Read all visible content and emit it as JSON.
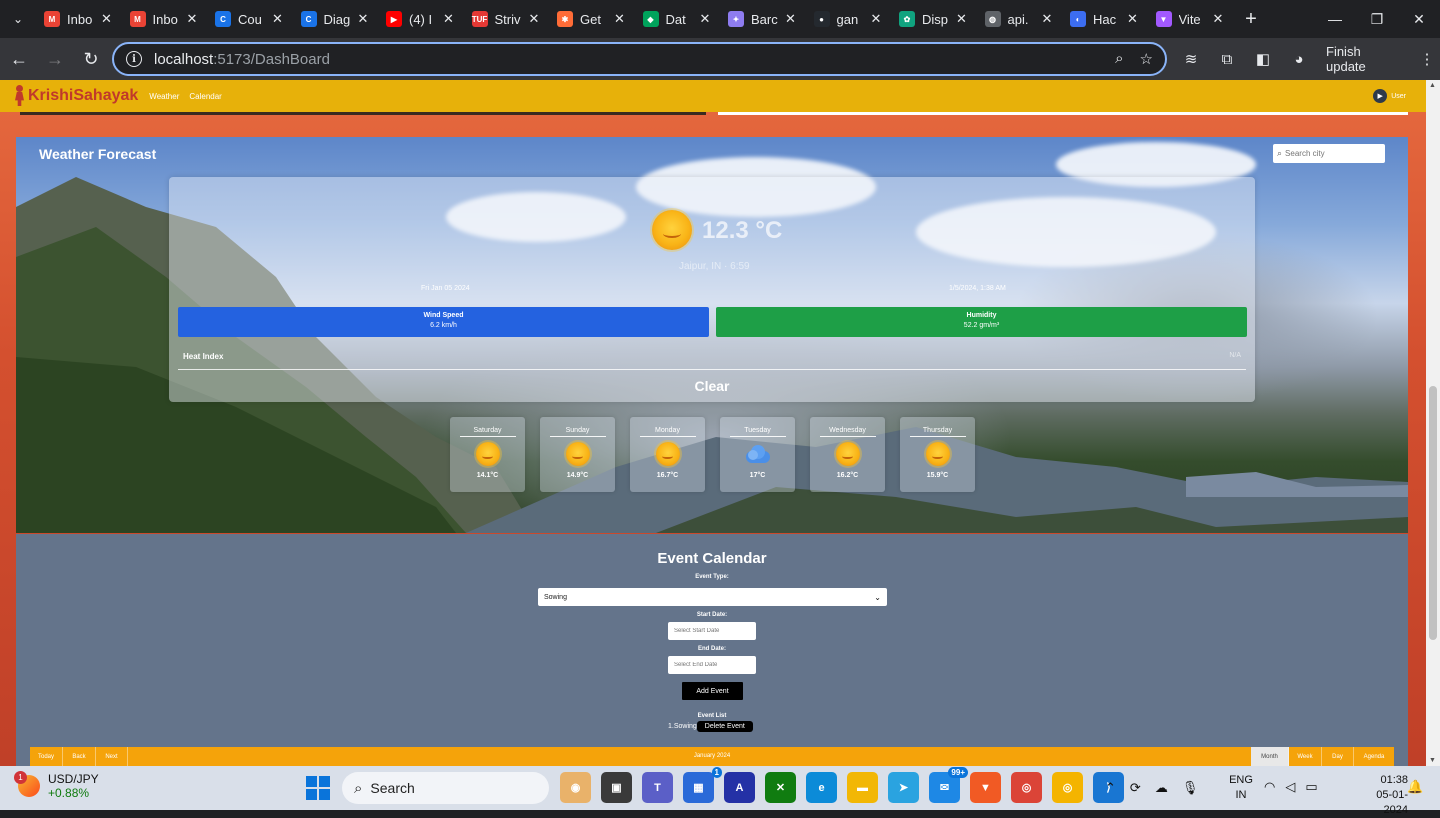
{
  "browser": {
    "tabs": [
      {
        "label": "Inbo",
        "icon": "gmail-icon",
        "color": "#ea4335",
        "glyph": "M"
      },
      {
        "label": "Inbo",
        "icon": "gmail-icon",
        "color": "#ea4335",
        "glyph": "M"
      },
      {
        "label": "Cou",
        "icon": "coursera-icon",
        "color": "#1a73e8",
        "glyph": "C"
      },
      {
        "label": "Diag",
        "icon": "coursera-icon",
        "color": "#1a73e8",
        "glyph": "C"
      },
      {
        "label": "(4) I",
        "icon": "youtube-icon",
        "color": "#ff0000",
        "glyph": "▶"
      },
      {
        "label": "Striv",
        "icon": "tuf-icon",
        "color": "#e53935",
        "glyph": "TUF"
      },
      {
        "label": "Get",
        "icon": "postman-icon",
        "color": "#ff6c37",
        "glyph": "✱"
      },
      {
        "label": "Dat",
        "icon": "mongodb-icon",
        "color": "#00a35c",
        "glyph": "◆"
      },
      {
        "label": "Barc",
        "icon": "bard-icon",
        "color": "#8e7cf0",
        "glyph": "✦"
      },
      {
        "label": "gan",
        "icon": "github-icon",
        "color": "#24292f",
        "glyph": "●"
      },
      {
        "label": "Disp",
        "icon": "chatgpt-icon",
        "color": "#10a37f",
        "glyph": "✿"
      },
      {
        "label": "api.",
        "icon": "globe-icon",
        "color": "#5f6368",
        "glyph": "◍"
      },
      {
        "label": "Hac",
        "icon": "hackathon-icon",
        "color": "#3c6df0",
        "glyph": "◐"
      },
      {
        "label": "Vite",
        "icon": "vite-icon",
        "color": "#a259ff",
        "glyph": "▼"
      }
    ],
    "url_host": "localhost",
    "url_path": ":5173/DashBoard",
    "finish_update": "Finish update"
  },
  "app": {
    "brand": "KrishiSahayak",
    "nav": [
      "Weather",
      "Calendar"
    ],
    "user": "User"
  },
  "weather": {
    "title": "Weather Forecast",
    "search_placeholder": "Search city",
    "current": {
      "temp": "12.3 °C",
      "location": "Jaipur, IN · 6:59",
      "date": "Fri Jan 05 2024",
      "time": "1/5/2024, 1:38 AM",
      "wind_label": "Wind Speed",
      "wind_value": "6.2 km/h",
      "humidity_label": "Humidity",
      "humidity_value": "52.2 gm/m³",
      "heat_label": "Heat Index",
      "heat_value": "N/A",
      "condition": "Clear"
    },
    "forecast": [
      {
        "day": "Saturday",
        "temp": "14.1°C",
        "icon": "sun-icon"
      },
      {
        "day": "Sunday",
        "temp": "14.9°C",
        "icon": "sun-icon"
      },
      {
        "day": "Monday",
        "temp": "16.7°C",
        "icon": "sun-icon"
      },
      {
        "day": "Tuesday",
        "temp": "17°C",
        "icon": "cloud-icon"
      },
      {
        "day": "Wednesday",
        "temp": "16.2°C",
        "icon": "sun-icon"
      },
      {
        "day": "Thursday",
        "temp": "15.9°C",
        "icon": "sun-icon"
      }
    ]
  },
  "calendar": {
    "title": "Event Calendar",
    "event_type_label": "Event Type:",
    "event_type_value": "Sowing",
    "start_label": "Start Date:",
    "start_placeholder": "Select Start Date",
    "end_label": "End Date:",
    "end_placeholder": "Select End Date",
    "add_button": "Add Event",
    "list_label": "Event List",
    "events": [
      {
        "name": "1.Sowing",
        "delete": "Delete Event"
      }
    ],
    "toolbar": {
      "today": "Today",
      "back": "Back",
      "next": "Next",
      "month_label": "January 2024",
      "views": [
        "Month",
        "Week",
        "Day",
        "Agenda"
      ],
      "active_view": "Month"
    }
  },
  "taskbar": {
    "ticker_name": "USD/JPY",
    "ticker_change": "+0.88%",
    "ticker_badge": "1",
    "search": "Search",
    "mail_badge": "99+",
    "store_badge": "1",
    "lang_top": "ENG",
    "lang_bottom": "IN",
    "time": "01:38",
    "date": "05-01-2024"
  }
}
